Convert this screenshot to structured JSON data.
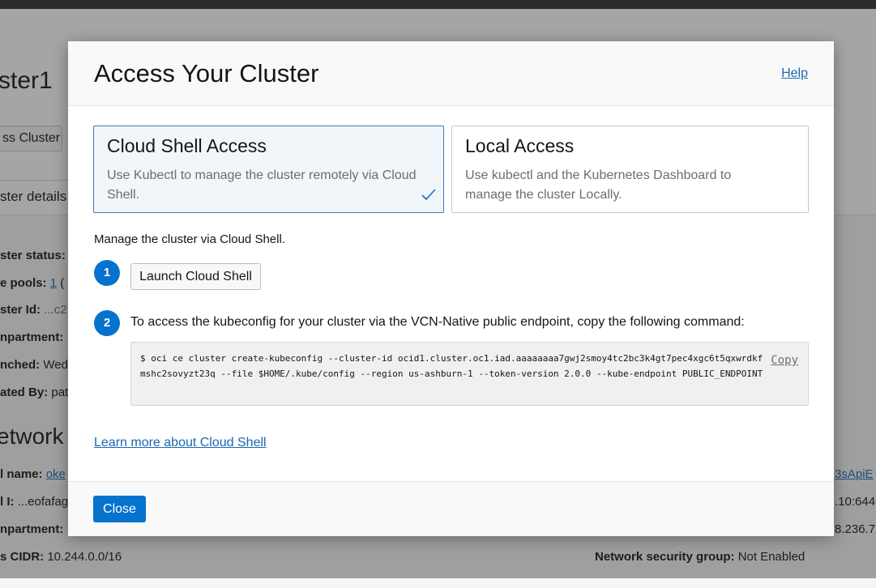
{
  "background": {
    "cluster_title": "ster1",
    "cluster_button_label": "ss Cluster",
    "tab_label": "ster details",
    "rows": [
      {
        "label": "ster status:",
        "value": ""
      },
      {
        "label": "e pools:",
        "value": "1",
        "extra": "("
      },
      {
        "label": "ster Id:",
        "value": "...c2"
      },
      {
        "label": "npartment:",
        "value": ""
      },
      {
        "label": "nched:",
        "value": "Wed"
      },
      {
        "label": "ated By:",
        "value": "pat"
      }
    ],
    "network_heading": "etwork i",
    "network_rows": [
      {
        "label": "l name:",
        "value": "oke"
      },
      {
        "label": "l I:",
        "value": "...eofafag"
      },
      {
        "label": "npartment:",
        "value": ""
      },
      {
        "label": "s CIDR:",
        "value": "10.244.0.0/16"
      }
    ],
    "right_values": [
      "3sApiE",
      ".10:644",
      "8.236.7"
    ],
    "nsg_label": "Network security group:",
    "nsg_value": "Not Enabled"
  },
  "modal": {
    "title": "Access Your Cluster",
    "help_label": "Help",
    "options": [
      {
        "title": "Cloud Shell Access",
        "description": "Use Kubectl to manage the cluster remotely via Cloud Shell.",
        "selected": true
      },
      {
        "title": "Local Access",
        "description": "Use kubectl and the Kubernetes Dashboard to manage the cluster Locally.",
        "selected": false
      }
    ],
    "instructions": "Manage the cluster via Cloud Shell.",
    "steps": [
      {
        "number": "1",
        "button_label": "Launch Cloud Shell"
      },
      {
        "number": "2",
        "text": "To access the kubeconfig for your cluster via the VCN-Native public endpoint, copy the following command:"
      }
    ],
    "command": "$ oci ce cluster create-kubeconfig --cluster-id ocid1.cluster.oc1.iad.aaaaaaaa7gwj2smoy4tc2bc3k4gt7pec4xgc6t5qxwrdkfmshc2sovyzt23q --file $HOME/.kube/config --region us-ashburn-1 --token-version 2.0.0  --kube-endpoint PUBLIC_ENDPOINT",
    "copy_label": "Copy",
    "learn_more_label": "Learn more about Cloud Shell",
    "close_label": "Close"
  },
  "colors": {
    "primary": "#0572ce",
    "link": "#1a68b3",
    "selected_card_bg": "#f1f6fb",
    "selected_card_border": "#3a7cb8"
  },
  "icons": {
    "check": "check-icon"
  }
}
